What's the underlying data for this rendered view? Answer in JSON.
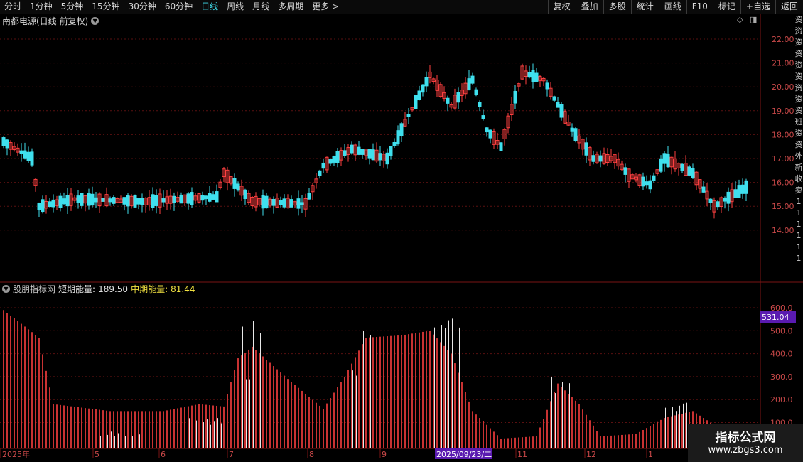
{
  "toolbar": {
    "left": [
      "分时",
      "1分钟",
      "5分钟",
      "15分钟",
      "30分钟",
      "60分钟",
      "日线",
      "周线",
      "月线",
      "多周期",
      "更多 >"
    ],
    "active_index": 6,
    "right": [
      "复权",
      "叠加",
      "多股",
      "统计",
      "画线",
      "F10",
      "标记",
      "+自选",
      "返回"
    ]
  },
  "main": {
    "title": "南都电源(日线 前复权)",
    "price_axis": [
      "22.00",
      "21.00",
      "20.00",
      "19.00",
      "18.00",
      "17.00",
      "16.00",
      "15.00",
      "14.00"
    ]
  },
  "indicator": {
    "name": "股朋指标网",
    "short_label": "短期能量:",
    "short_value": "189.50",
    "mid_label": "中期能量:",
    "mid_value": "81.44",
    "axis": [
      "600.0",
      "500.0",
      "400.0",
      "300.0",
      "200.0",
      "100.0"
    ],
    "highlight": "531.04"
  },
  "dates": {
    "labels": [
      "2025年",
      "5",
      "6",
      "7",
      "8",
      "9",
      "11",
      "12",
      "1"
    ],
    "cursor": "2025/09/23/二"
  },
  "right_col": [
    "资",
    "资",
    "资",
    "资",
    "资",
    "资",
    "资",
    "资",
    "资",
    "班",
    "资",
    "资",
    "外",
    "新",
    "收",
    "卖",
    "1",
    "1",
    "1",
    "1",
    "1",
    "1"
  ],
  "watermark": {
    "line1": "指标公式网",
    "line2": "www.zbgs3.com"
  },
  "colors": {
    "up": "#ff4040",
    "down": "#3fe0ee",
    "energy": "#c83232",
    "grid": "#5a1010"
  }
}
